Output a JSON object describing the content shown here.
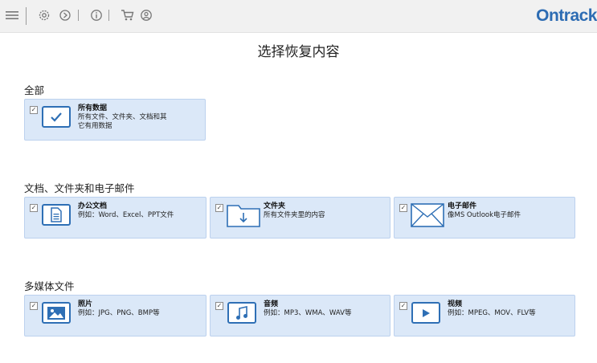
{
  "brand": {
    "name": "Ontrack"
  },
  "page": {
    "title": "选择恢复内容"
  },
  "toolbar": {
    "icons": [
      "menu-icon",
      "gear-icon",
      "restore-icon",
      "info-icon",
      "cart-icon",
      "user-icon"
    ]
  },
  "sections": {
    "all": {
      "title": "全部",
      "cards": [
        {
          "title": "所有数据",
          "desc_line1": "所有文件、文件夹、文档和其",
          "desc_line2": "它有用数据",
          "checked": true
        }
      ]
    },
    "docs": {
      "title": "文档、文件夹和电子邮件",
      "cards": [
        {
          "title": "办公文档",
          "desc": "例如：Word、Excel、PPT文件",
          "checked": true
        },
        {
          "title": "文件夹",
          "desc": "所有文件夹里的内容",
          "checked": true
        },
        {
          "title": "电子邮件",
          "desc": "像MS Outlook电子邮件",
          "checked": true
        }
      ]
    },
    "media": {
      "title": "多媒体文件",
      "cards": [
        {
          "title": "照片",
          "desc": "例如：JPG、PNG、BMP等",
          "checked": true
        },
        {
          "title": "音频",
          "desc": "例如：MP3、WMA、WAV等",
          "checked": true
        },
        {
          "title": "视频",
          "desc": "例如：MPEG、MOV、FLV等",
          "checked": true
        }
      ]
    }
  },
  "colors": {
    "accent": "#2e6fb5",
    "card_bg": "#dbe8f8",
    "toolbar_bg": "#f1f1f1"
  }
}
